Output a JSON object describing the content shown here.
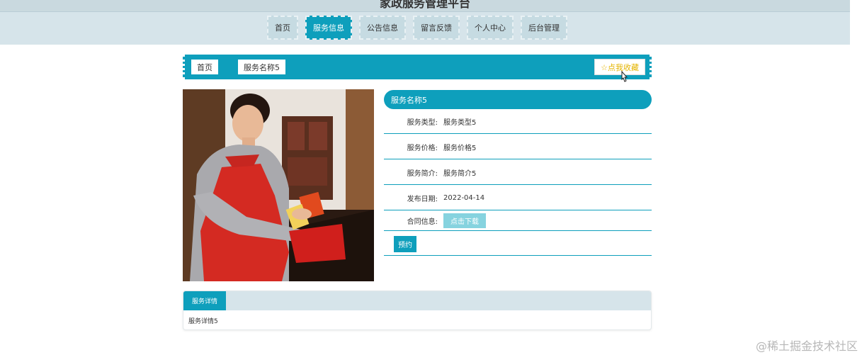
{
  "header": {
    "site_title": "家政服务管理平台"
  },
  "nav": {
    "items": [
      {
        "label": "首页",
        "active": false
      },
      {
        "label": "服务信息",
        "active": true
      },
      {
        "label": "公告信息",
        "active": false
      },
      {
        "label": "留言反馈",
        "active": false
      },
      {
        "label": "个人中心",
        "active": false
      },
      {
        "label": "后台管理",
        "active": false
      }
    ]
  },
  "breadcrumb": {
    "home": "首页",
    "current": "服务名称5"
  },
  "favorite": {
    "label": "☆点我收藏"
  },
  "detail": {
    "title": "服务名称5",
    "rows": [
      {
        "label": "服务类型:",
        "value": "服务类型5"
      },
      {
        "label": "服务价格:",
        "value": "服务价格5"
      },
      {
        "label": "服务简介:",
        "value": "服务简介5"
      },
      {
        "label": "发布日期:",
        "value": "2022-04-14"
      }
    ],
    "contract_label": "合同信息:",
    "download_label": "点击下载",
    "book_label": "预约"
  },
  "tabs": {
    "active": "服务详情",
    "content": "服务详情5"
  },
  "watermark": "@稀土掘金技术社区",
  "colors": {
    "accent": "#0e9fbc",
    "nav_bg": "#d6e4ea",
    "favorite": "#e4b400"
  }
}
